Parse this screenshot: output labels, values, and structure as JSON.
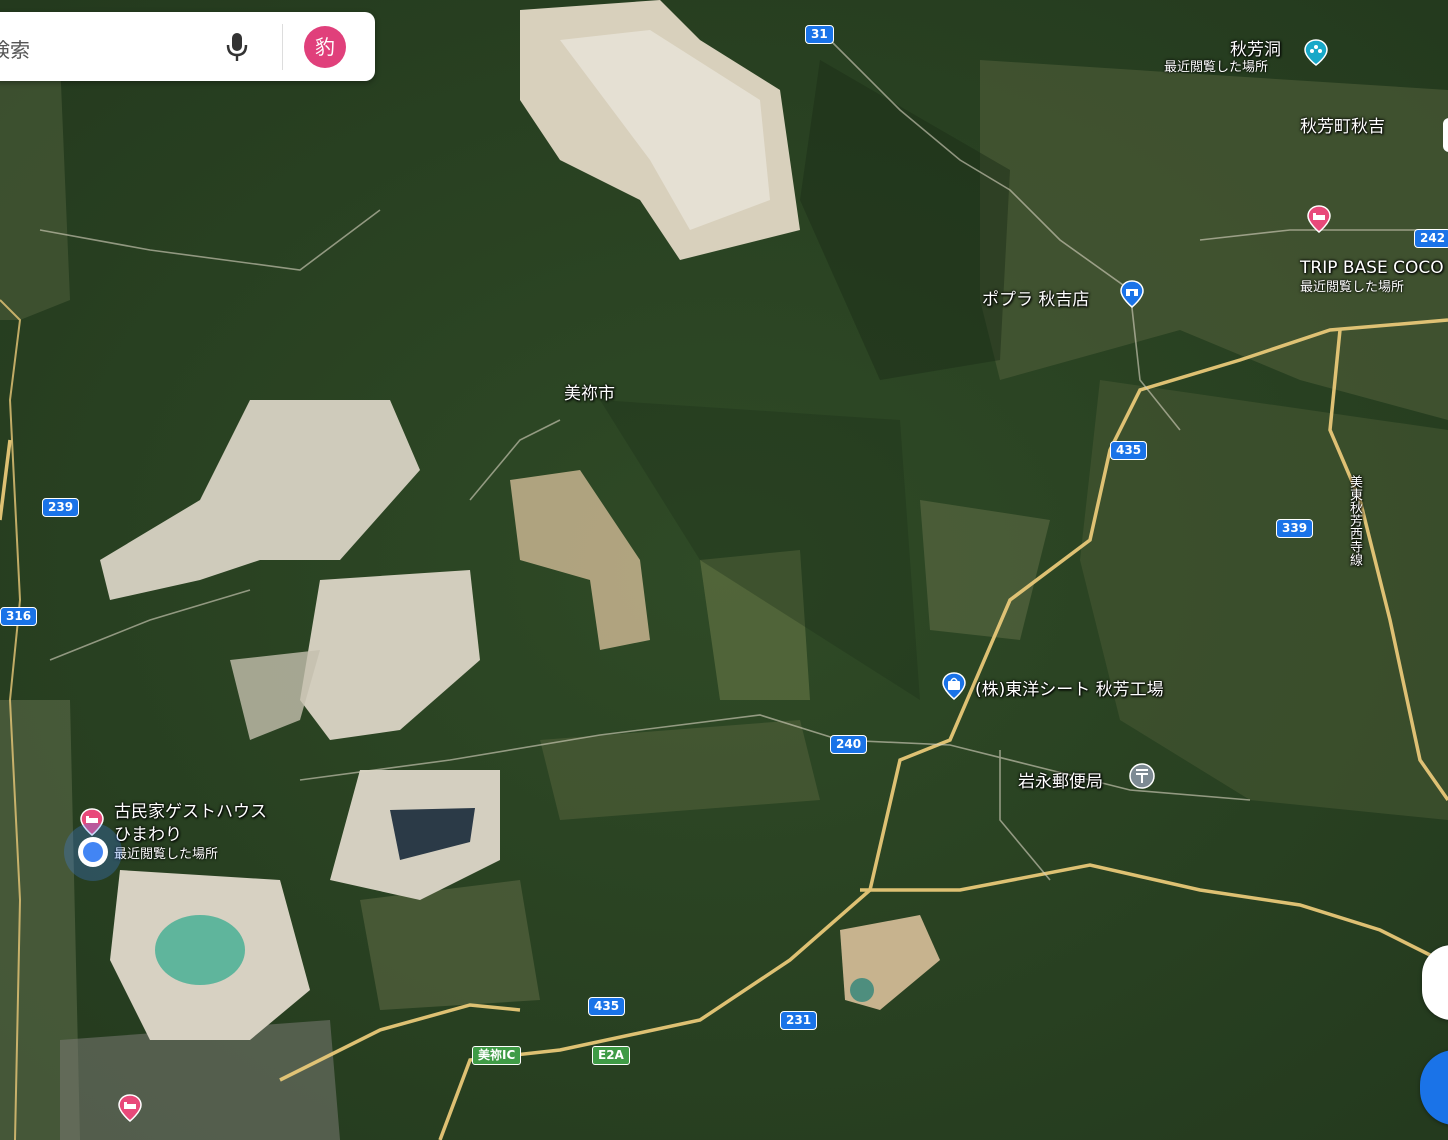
{
  "search": {
    "placeholder": "検索",
    "avatar_label": "豹"
  },
  "map": {
    "city_label": "美祢市",
    "places": {
      "akiyoshido": {
        "name": "秋芳洞",
        "sub": "最近閲覧した場所"
      },
      "akiyoshi_town": {
        "name": "秋芳町秋吉"
      },
      "trip_base": {
        "name": "TRIP BASE COCO",
        "sub": "最近閲覧した場所"
      },
      "popla": {
        "name": "ポプラ 秋吉店"
      },
      "toyo_sheet": {
        "name": "(株)東洋シート 秋芳工場"
      },
      "iwanaga_post": {
        "name": "岩永郵便局"
      },
      "guesthouse": {
        "name_line1": "古民家ゲストハウス",
        "name_line2": "ひまわり",
        "sub": "最近閲覧した場所"
      },
      "road_name": {
        "name": "美東秋芳西寺線"
      }
    },
    "route_shields": [
      "31",
      "242",
      "435",
      "339",
      "239",
      "316",
      "240",
      "435",
      "231"
    ],
    "expressway": {
      "ic": "美祢IC",
      "code": "E2A"
    }
  },
  "colors": {
    "route_shield": "#1a73e8",
    "expressway": "#3f9b46",
    "pin_pink": "#e8497a",
    "pin_blue": "#1a73e8",
    "road": "#e8c878"
  },
  "icons": [
    "mic-icon",
    "cave-icon",
    "hotel-icon",
    "convenience-store-icon",
    "shopping-icon",
    "post-office-icon",
    "my-location-icon"
  ]
}
